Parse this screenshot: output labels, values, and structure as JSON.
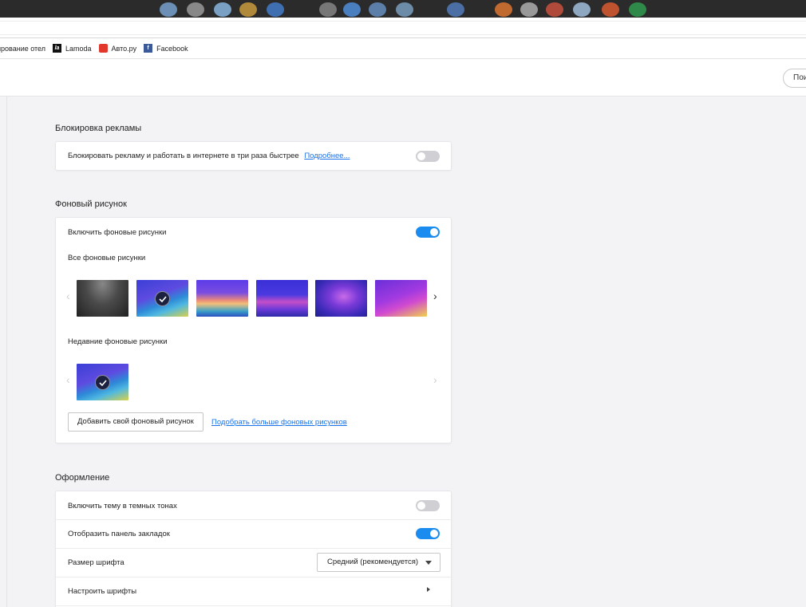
{
  "bookmarks": [
    {
      "label": "ирование отел",
      "icon": "none"
    },
    {
      "label": "Lamoda",
      "icon": "lamoda-icon"
    },
    {
      "label": "Авто.ру",
      "icon": "autoru-icon"
    },
    {
      "label": "Facebook",
      "icon": "facebook-icon"
    }
  ],
  "header": {
    "search_button_label": "Пои"
  },
  "adblock": {
    "title": "Блокировка рекламы",
    "row_label": "Блокировать рекламу и работать в интернете в три раза быстрее",
    "more_link": "Подробнее...",
    "enabled": false
  },
  "wallpaper": {
    "title": "Фоновый рисунок",
    "enable_label": "Включить фоновые рисунки",
    "enabled": true,
    "all_label": "Все фоновые рисунки",
    "recent_label": "Недавние фоновые рисунки",
    "add_button": "Добавить свой фоновый рисунок",
    "more_link": "Подобрать больше фоновых рисунков",
    "selected_index": 1
  },
  "appearance": {
    "title": "Оформление",
    "dark_theme_label": "Включить тему в темных тонах",
    "dark_theme_enabled": false,
    "bookmarks_bar_label": "Отобразить панель закладок",
    "bookmarks_bar_enabled": true,
    "font_size_label": "Размер шрифта",
    "font_size_value": "Средний (рекомендуется)",
    "customize_fonts_label": "Настроить шрифты"
  },
  "colors": {
    "accent": "#1a8cf0",
    "link": "#1a73e8"
  }
}
